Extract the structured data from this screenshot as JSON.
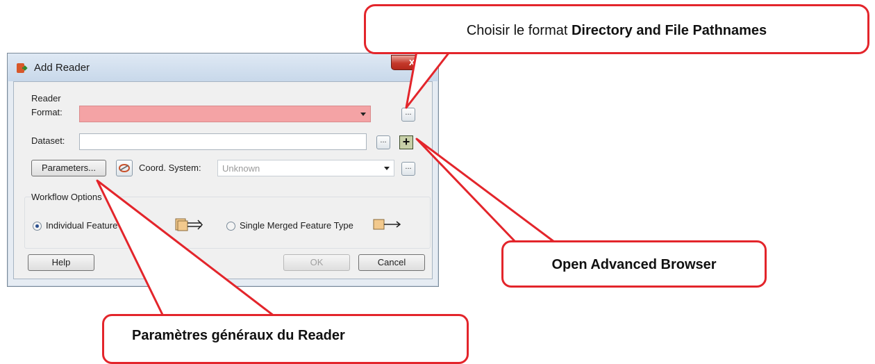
{
  "dialog": {
    "title": "Add Reader",
    "close_label": "x",
    "reader_group_label": "Reader",
    "format_label": "Format:",
    "format_value": "",
    "format_browse": "...",
    "dataset_label": "Dataset:",
    "dataset_value": "",
    "dataset_browse": "...",
    "advanced_browser": "+",
    "parameters_button": "Parameters...",
    "coord_label": "Coord. System:",
    "coord_value": "Unknown",
    "coord_browse": "...",
    "workflow_group_label": "Workflow Options",
    "option_individual": "Individual Feature Types",
    "option_single": "Single Merged Feature Type",
    "selected_option": "Individual Feature Types",
    "help_button": "Help",
    "ok_button": "OK",
    "cancel_button": "Cancel"
  },
  "callouts": {
    "format_prefix": "Choisir le format ",
    "format_bold": "Directory and File Pathnames",
    "advanced": "Open Advanced Browser",
    "parameters": "Paramètres généraux du Reader"
  },
  "colors": {
    "callout_border": "#e3252b",
    "required_field": "#f4a3a5",
    "close_button": "#c4382a"
  }
}
